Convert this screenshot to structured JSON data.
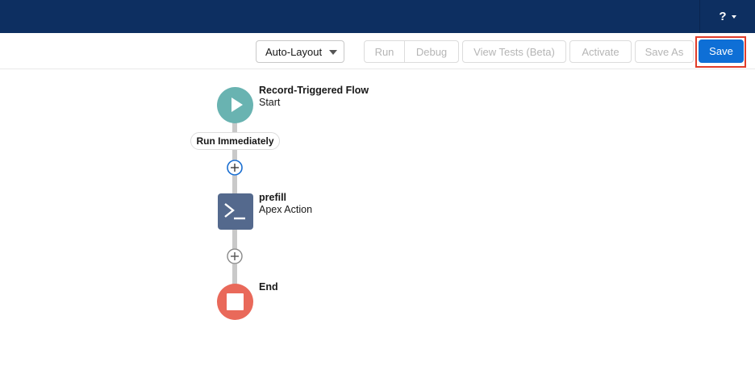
{
  "header": {
    "help_label": "?"
  },
  "toolbar": {
    "layout_select": "Auto-Layout",
    "buttons": {
      "run": "Run",
      "debug": "Debug",
      "view_tests": "View Tests (Beta)",
      "activate": "Activate",
      "save_as": "Save As",
      "save": "Save"
    }
  },
  "flow": {
    "start": {
      "title": "Record-Triggered Flow",
      "subtitle": "Start"
    },
    "path_label": "Run Immediately",
    "action": {
      "title": "prefill",
      "subtitle": "Apex Action"
    },
    "end": {
      "title": "End"
    }
  },
  "colors": {
    "header_bg": "#0d2f61",
    "save_button": "#0e6fd6",
    "start_node": "#69b3b1",
    "apex_node": "#54698d",
    "end_node": "#e9695a",
    "highlight": "#e03c2a"
  }
}
